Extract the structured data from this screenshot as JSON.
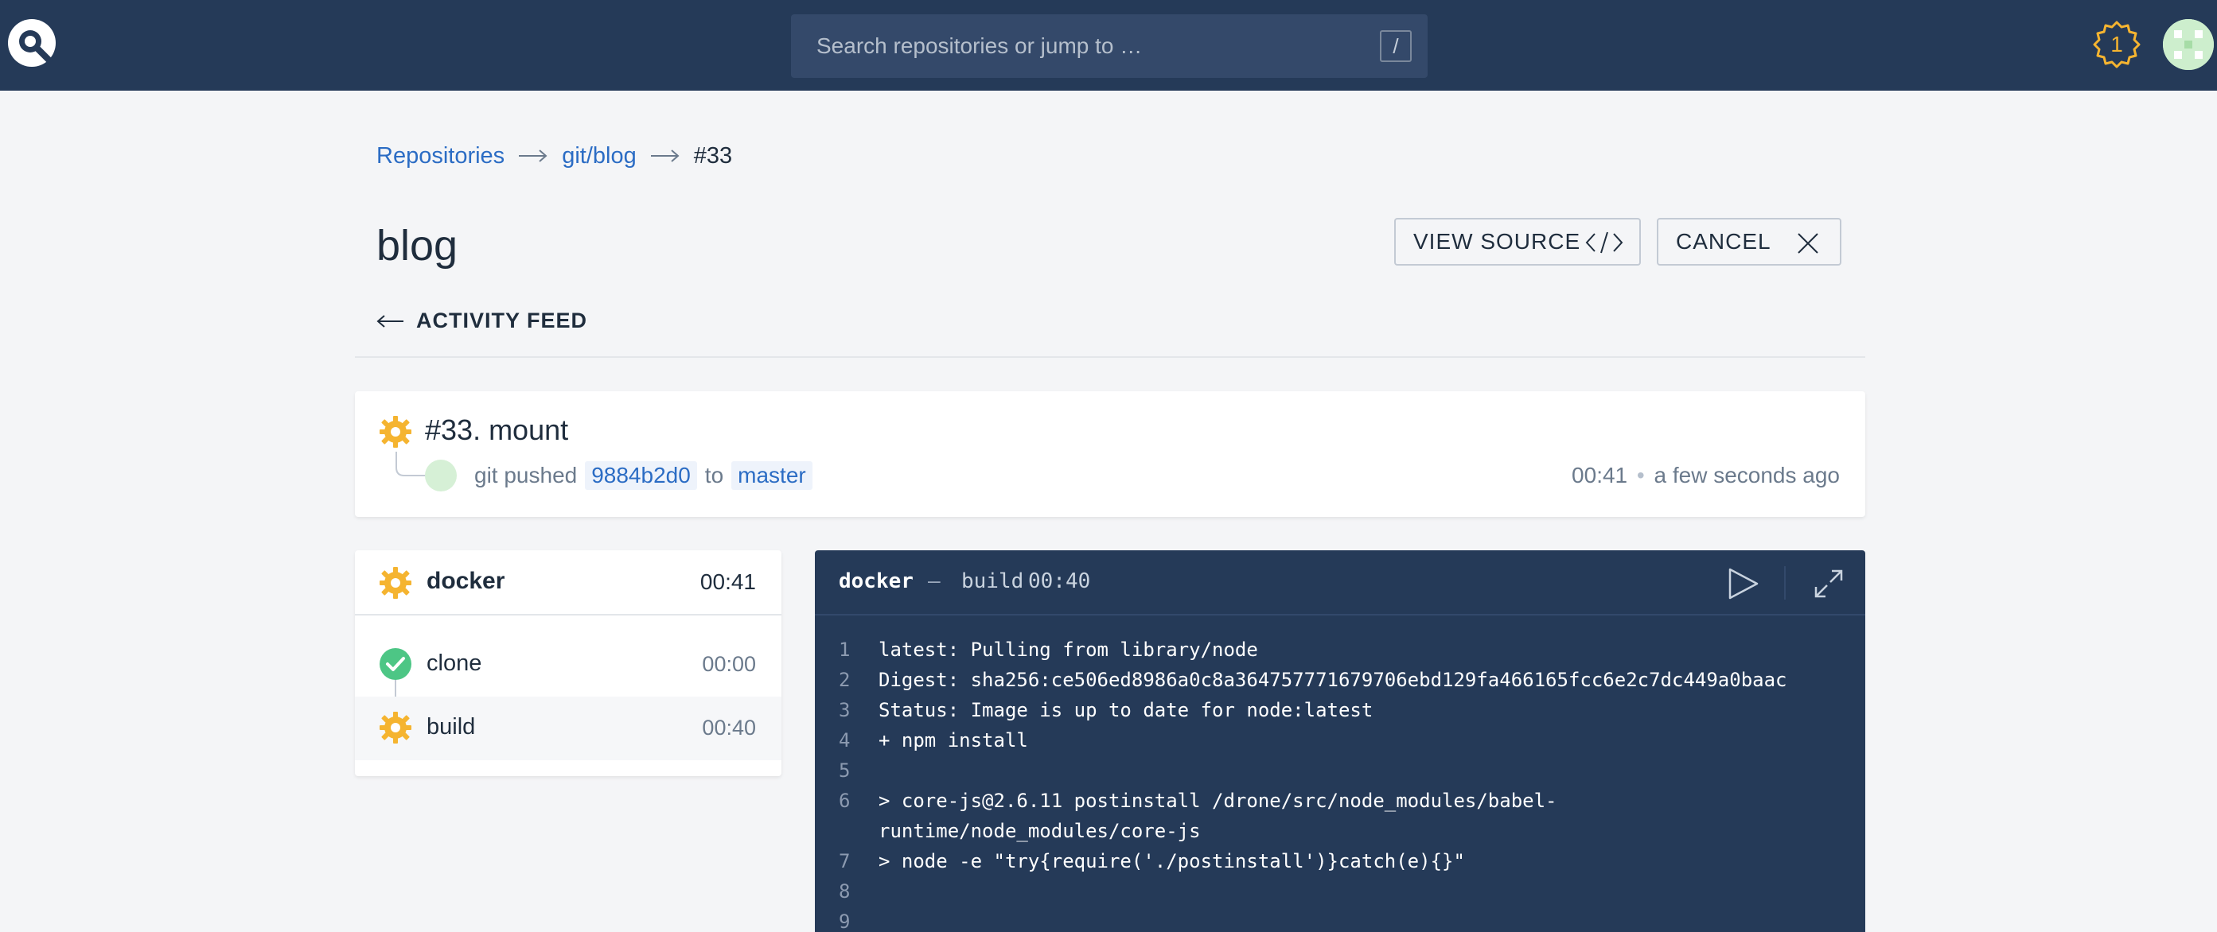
{
  "header": {
    "search_placeholder": "Search repositories or jump to …",
    "search_shortcut": "/",
    "notification_count": "1"
  },
  "breadcrumb": {
    "items": [
      "Repositories",
      "git/blog",
      "#33"
    ]
  },
  "page": {
    "title": "blog",
    "view_source_label": "VIEW SOURCE",
    "cancel_label": "CANCEL",
    "activity_feed_label": "ACTIVITY FEED"
  },
  "build": {
    "title": "#33. mount",
    "author_action": "git pushed",
    "commit": "9884b2d0",
    "to_label": "to",
    "branch": "master",
    "duration": "00:41",
    "separator": "•",
    "relative_time": "a few seconds ago"
  },
  "stage": {
    "name": "docker",
    "duration": "00:41",
    "steps": [
      {
        "name": "clone",
        "duration": "00:00",
        "status": "success"
      },
      {
        "name": "build",
        "duration": "00:40",
        "status": "running"
      }
    ]
  },
  "log": {
    "stage": "docker",
    "separator": "—",
    "step": "build",
    "duration": "00:40",
    "lines": [
      {
        "num": "1",
        "text": "latest: Pulling from library/node"
      },
      {
        "num": "2",
        "text": "Digest: sha256:ce506ed8986a0c8a364757771679706ebd129fa466165fcc6e2c7dc449a0baac"
      },
      {
        "num": "3",
        "text": "Status: Image is up to date for node:latest"
      },
      {
        "num": "4",
        "text": "+ npm install"
      },
      {
        "num": "5",
        "text": ""
      },
      {
        "num": "6",
        "text": "> core-js@2.6.11 postinstall /drone/src/node_modules/babel-\nruntime/node_modules/core-js"
      },
      {
        "num": "7",
        "text": "> node -e \"try{require('./postinstall')}catch(e){}\""
      },
      {
        "num": "8",
        "text": ""
      },
      {
        "num": "9",
        "text": ""
      }
    ]
  },
  "colors": {
    "navbar": "#253a58",
    "link": "#2b6cc4",
    "running": "#f5b430",
    "success": "#4dc685"
  }
}
